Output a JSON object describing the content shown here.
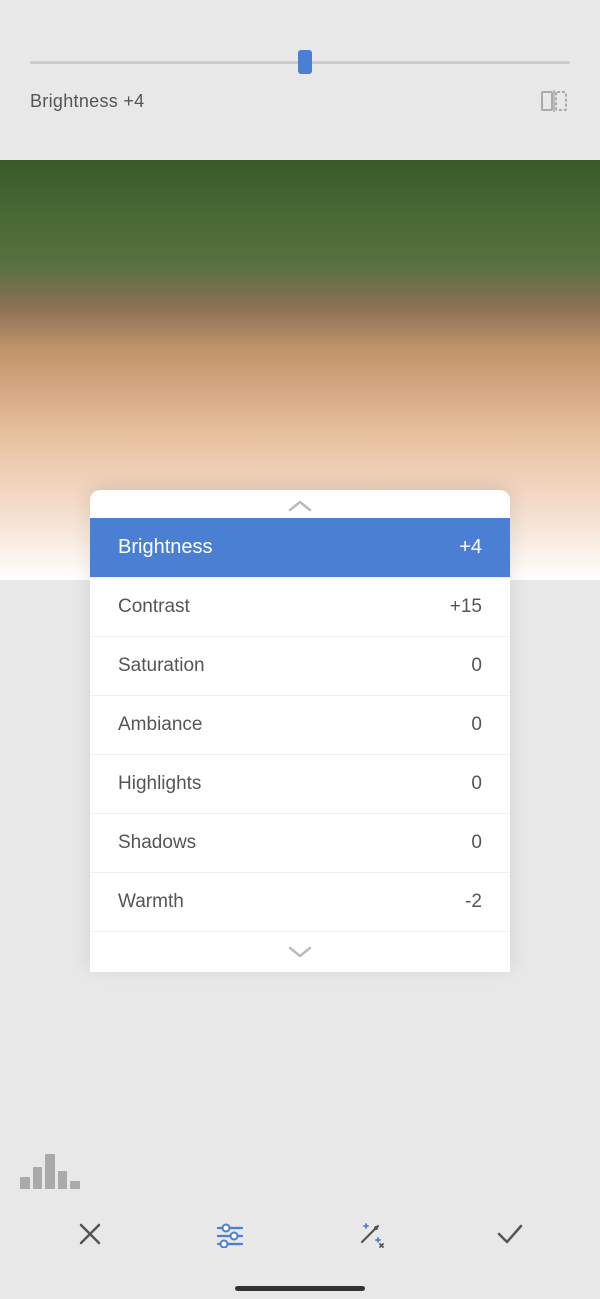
{
  "slider": {
    "label": "Brightness +4",
    "value": "+4",
    "name": "Brightness",
    "position_pct": 51
  },
  "compare_icon": "compare-icon",
  "panel": {
    "chevron_up": "^",
    "chevron_down": "v",
    "items": [
      {
        "name": "Brightness",
        "value": "+4",
        "active": true
      },
      {
        "name": "Contrast",
        "value": "+15",
        "active": false
      },
      {
        "name": "Saturation",
        "value": "0",
        "active": false
      },
      {
        "name": "Ambiance",
        "value": "0",
        "active": false
      },
      {
        "name": "Highlights",
        "value": "0",
        "active": false
      },
      {
        "name": "Shadows",
        "value": "0",
        "active": false
      },
      {
        "name": "Warmth",
        "value": "-2",
        "active": false
      }
    ]
  },
  "toolbar": {
    "cancel_label": "×",
    "adjust_label": "adjust",
    "auto_label": "auto",
    "confirm_label": "✓"
  },
  "histogram": {
    "bars": [
      12,
      22,
      35,
      18,
      8
    ]
  }
}
